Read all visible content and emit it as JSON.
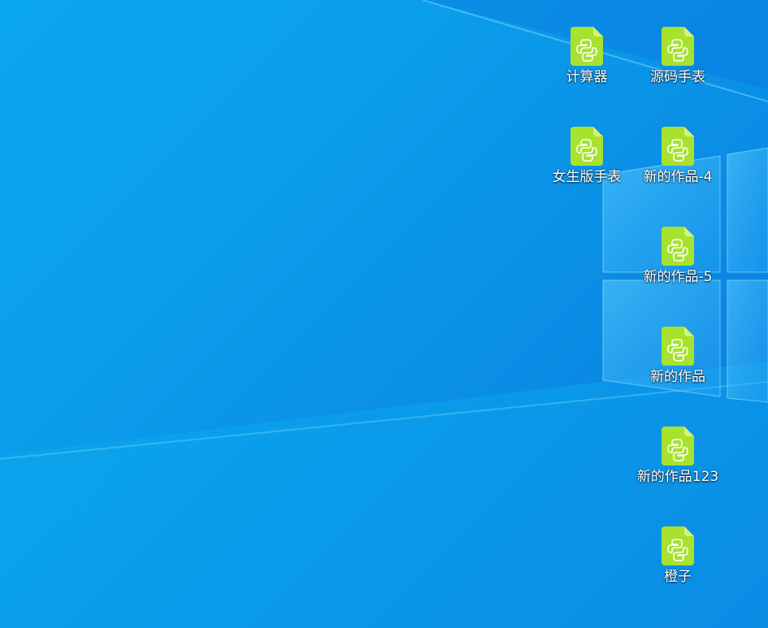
{
  "desktop": {
    "icons": [
      {
        "label": "计算器",
        "type": "python-file-icon"
      },
      {
        "label": "源码手表",
        "type": "python-file-icon"
      },
      {
        "label": "女生版手表",
        "type": "python-file-icon"
      },
      {
        "label": "新的作品-4",
        "type": "python-file-icon"
      },
      {
        "label": "新的作品-5",
        "type": "python-file-icon"
      },
      {
        "label": "新的作品",
        "type": "python-file-icon"
      },
      {
        "label": "新的作品123",
        "type": "python-file-icon"
      },
      {
        "label": "橙子",
        "type": "python-file-icon"
      }
    ]
  },
  "colors": {
    "icon_fill": "#a6e22e",
    "icon_fold": "#d4f27a",
    "logo_stroke": "#ffffff"
  }
}
